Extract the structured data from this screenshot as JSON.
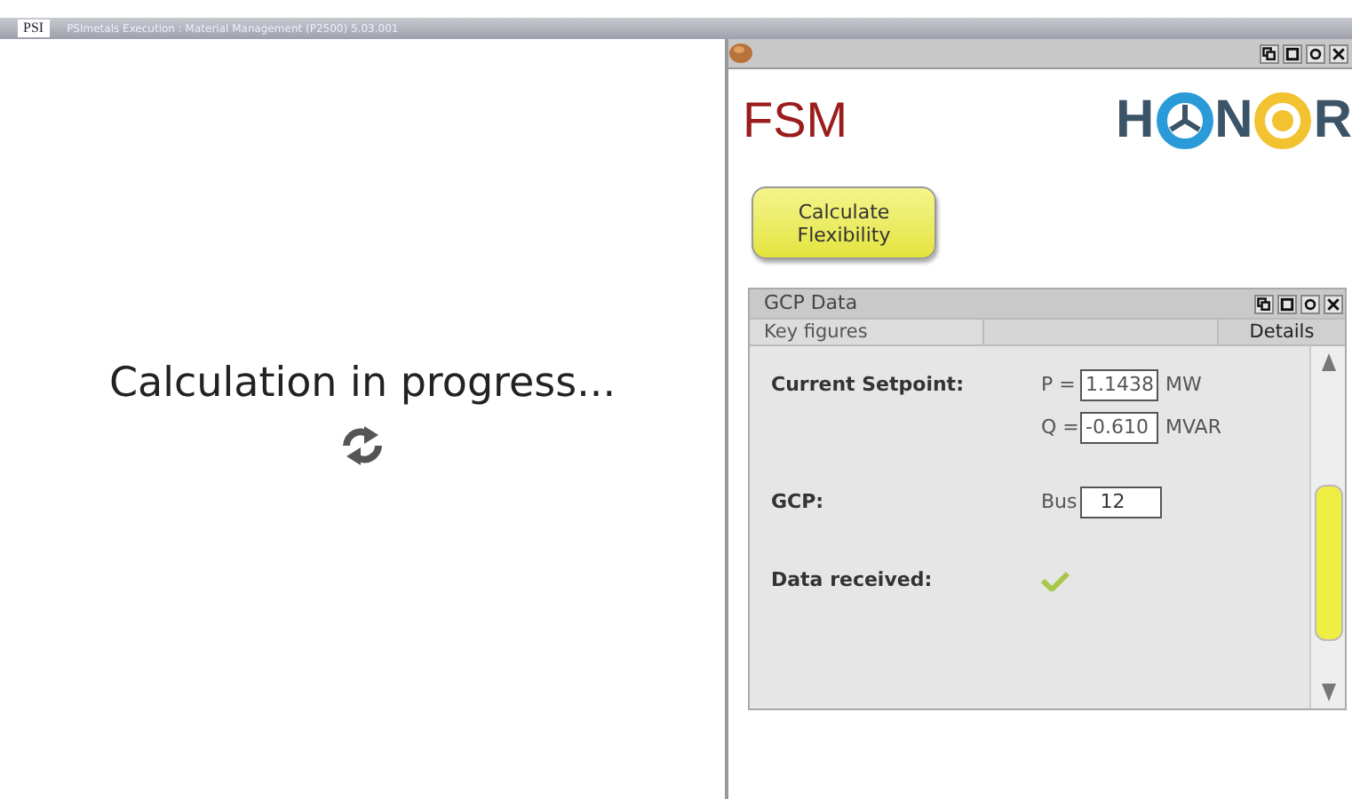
{
  "window": {
    "logo": "PSI",
    "title": "PSImetals Execution : Material Management (P2500) 5.03.001"
  },
  "progress": {
    "message": "Calculation in progress..."
  },
  "app": {
    "name": "FSM",
    "logo_letters": [
      "H",
      "N",
      "R"
    ],
    "calculate_button": "Calculate Flexibility"
  },
  "gcp_panel": {
    "title": "GCP Data",
    "tabs": [
      {
        "label": "Key figures",
        "selected": true
      },
      {
        "label": "Details",
        "selected": false
      }
    ],
    "setpoint": {
      "label": "Current Setpoint:",
      "p_label": "P =",
      "p_value": "1.1438",
      "p_unit": "MW",
      "q_label": "Q =",
      "q_value": "-0.610",
      "q_unit": "MVAR"
    },
    "gcp": {
      "label": "GCP:",
      "prefix": "Bus",
      "value": "12"
    },
    "data_received": {
      "label": "Data received:",
      "checked": true
    }
  }
}
